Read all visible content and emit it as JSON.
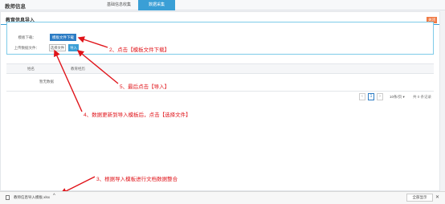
{
  "header": {
    "app_title": "教师信息",
    "tabs": [
      {
        "label": "基础信息收集"
      },
      {
        "label": "数据采集"
      }
    ]
  },
  "panel": {
    "title": "教育信息导入",
    "close_label": "关闭",
    "upload": {
      "template_label": "模板下载：",
      "template_button": "模板文件下载",
      "upload_label": "上传数据文件：",
      "choose_button": "选择文件",
      "import_button": "导入"
    },
    "table": {
      "columns": [
        "姓名",
        "教育经历"
      ],
      "empty_text": "暂无数据"
    },
    "pagination": {
      "prev": "‹",
      "page": "1",
      "next": "›",
      "page_size": "10条/页 ▾",
      "total": "共 0 条记录"
    }
  },
  "annotations": {
    "step2": "2、点击【模板文件下载】",
    "step5": "5、最后点击【导入】",
    "step4": "4、数据更新到导入模板后，点击【选择文件】",
    "step3": "3、根据导入模板进行文档数据整合"
  },
  "download_bar": {
    "file_name": "教师信息导入模板.xlsx",
    "chevron": "^",
    "show_all": "全部显示",
    "close": "✕"
  },
  "colors": {
    "accent": "#3a9fd6",
    "button_dark": "#2c7cc4",
    "annotation": "#e0141a",
    "close_button": "#f07a44"
  }
}
